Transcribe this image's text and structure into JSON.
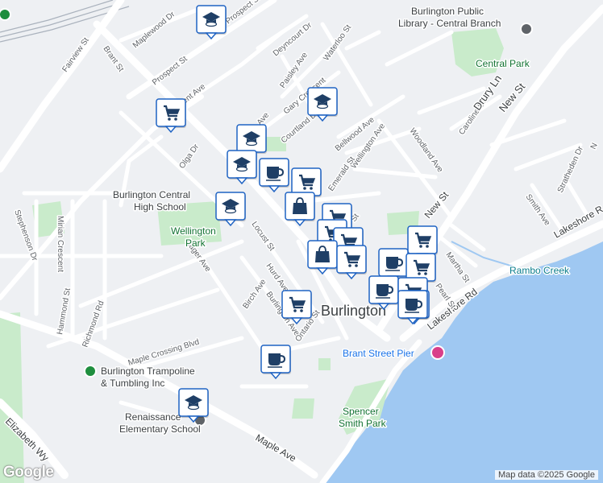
{
  "map": {
    "colors": {
      "land": "#eef0f3",
      "water": "#9fc8f2",
      "park": "#c9ebcb",
      "road": "#ffffff",
      "arterial": "#ffffff",
      "rail": "#aab2bd",
      "marker_bg": "#ffffff",
      "marker_border": "#1f63c3",
      "marker_icon": "#1f3f66"
    },
    "labels": {
      "city": "Burlington",
      "streets": {
        "fairview": "Fairview St",
        "brant": "Brant St",
        "maplewood": "Maplewood Dr",
        "prospect_top": "Prospect St",
        "prospect": "Prospect St",
        "vent": "vent Ave",
        "olga": "Olga Dr",
        "deyncourt": "Deyncourt Dr",
        "paisley": "Paisley Ave",
        "waterloo": "Waterloo St",
        "gary": "Gary Crescent",
        "courtland": "Courtland Dr",
        "ave_frag": "Ave",
        "bellwood": "Bellwood Ave",
        "wellington_ave": "Wellington Ave",
        "emerald": "Emerald St",
        "woodland": "Woodland Ave",
        "caroline": "Caroline St",
        "drury": "Drury Ln",
        "new_st_top": "New St",
        "new_st": "New St",
        "stratheden": "Stratheden Dr",
        "smith": "Smith Ave",
        "lakeshore_right": "Lakeshore R",
        "lakeshore": "Lakeshore Rd",
        "martha": "Martha St",
        "pearl": "Pearl St",
        "st_frag": "St",
        "locust": "Locust St",
        "hurd": "Hurd Ave",
        "birch": "Birch Ave",
        "burlington_ave": "Burlington Ave",
        "ontario": "Ontario St",
        "hager": "Hager Ave",
        "stephenson": "Stephenson Dr",
        "mirian": "Mirian Crescent",
        "hammond": "Hammond St",
        "richmond": "Richmond Rd",
        "maple_crossing": "Maple Crossing Blvd",
        "maple_ave": "Maple Ave",
        "elizabeth": "Elizabeth Wy",
        "n_frag": "N"
      },
      "pois": {
        "library": "Burlington Public\nLibrary - Central Branch",
        "central_park": "Central Park",
        "high_school": "Burlington Central\nHigh School",
        "wellington_park": "Wellington\nPark",
        "rambo_creek": "Rambo Creek",
        "pier": "Brant Street Pier",
        "spencer_smith": "Spencer\nSmith Park",
        "trampoline": "Burlington Trampoline\n& Tumbling Inc",
        "renaissance": "Renaissance\nElementary School"
      }
    },
    "markers": [
      {
        "type": "school",
        "icon": "graduation-cap-icon"
      },
      {
        "type": "grocery",
        "icon": "shopping-cart-icon"
      },
      {
        "type": "school",
        "icon": "graduation-cap-icon"
      },
      {
        "type": "school",
        "icon": "graduation-cap-icon"
      },
      {
        "type": "school",
        "icon": "graduation-cap-icon"
      },
      {
        "type": "cafe",
        "icon": "coffee-cup-icon"
      },
      {
        "type": "grocery",
        "icon": "shopping-cart-icon"
      },
      {
        "type": "school",
        "icon": "graduation-cap-icon"
      },
      {
        "type": "shopping",
        "icon": "shopping-bag-icon"
      },
      {
        "type": "grocery",
        "icon": "shopping-cart-icon"
      },
      {
        "type": "grocery",
        "icon": "shopping-cart-icon"
      },
      {
        "type": "grocery",
        "icon": "shopping-cart-icon"
      },
      {
        "type": "shopping",
        "icon": "shopping-bag-icon"
      },
      {
        "type": "grocery",
        "icon": "shopping-cart-icon"
      },
      {
        "type": "grocery",
        "icon": "shopping-cart-icon"
      },
      {
        "type": "cafe",
        "icon": "coffee-cup-icon"
      },
      {
        "type": "grocery",
        "icon": "shopping-cart-icon"
      },
      {
        "type": "cafe",
        "icon": "coffee-cup-icon"
      },
      {
        "type": "grocery",
        "icon": "shopping-cart-icon"
      },
      {
        "type": "cafe",
        "icon": "coffee-cup-icon"
      },
      {
        "type": "cafe",
        "icon": "coffee-cup-icon"
      },
      {
        "type": "grocery",
        "icon": "shopping-cart-icon"
      },
      {
        "type": "cafe",
        "icon": "coffee-cup-icon"
      },
      {
        "type": "school",
        "icon": "graduation-cap-icon"
      }
    ],
    "attribution": "Map data ©2025 Google",
    "logo": "Google"
  }
}
